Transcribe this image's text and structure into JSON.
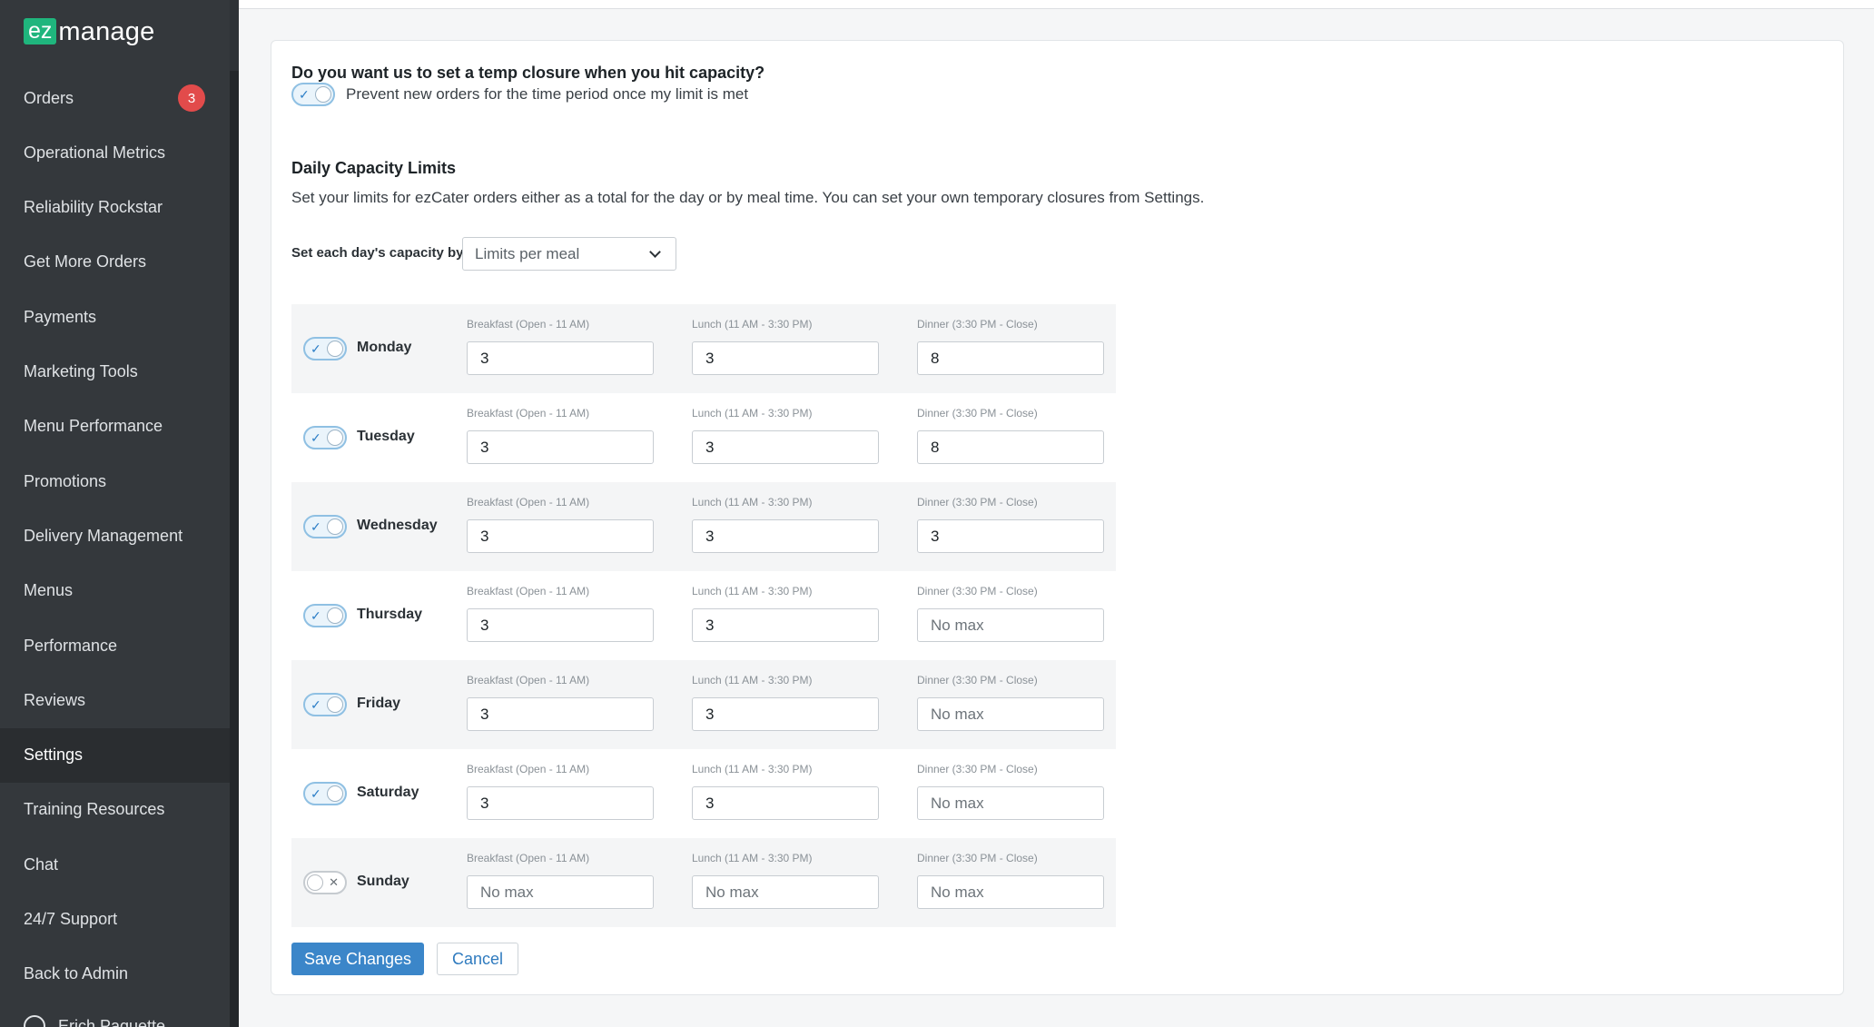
{
  "brand": {
    "logo_ez": "ez",
    "logo_manage": "manage"
  },
  "sidebar": {
    "items": [
      {
        "label": "Orders",
        "badge": "3"
      },
      {
        "label": "Operational Metrics"
      },
      {
        "label": "Reliability Rockstar"
      },
      {
        "label": "Get More Orders"
      },
      {
        "label": "Payments"
      },
      {
        "label": "Marketing Tools"
      },
      {
        "label": "Menu Performance"
      },
      {
        "label": "Promotions"
      },
      {
        "label": "Delivery Management"
      },
      {
        "label": "Menus"
      },
      {
        "label": "Performance"
      },
      {
        "label": "Reviews"
      },
      {
        "label": "Settings",
        "active": true
      },
      {
        "label": "Training Resources"
      },
      {
        "label": "Chat"
      },
      {
        "label": "24/7 Support"
      },
      {
        "label": "Back to Admin"
      }
    ],
    "user": "Erich Paquette"
  },
  "closure": {
    "question": "Do you want us to set a temp closure when you hit capacity?",
    "toggle_label": "Prevent new orders for the time period once my limit is met",
    "enabled": true
  },
  "capacity": {
    "title": "Daily Capacity Limits",
    "description": "Set your limits for ezCater orders either as a total for the day or by meal time. You can set your own temporary closures from Settings.",
    "set_by_label": "Set each day's capacity by",
    "set_by_value": "Limits per meal",
    "meal_labels": {
      "breakfast": "Breakfast (Open - 11 AM)",
      "lunch": "Lunch (11 AM - 3:30 PM)",
      "dinner": "Dinner (3:30 PM - Close)"
    },
    "placeholder": "No max",
    "days": [
      {
        "name": "Monday",
        "enabled": true,
        "breakfast": "3",
        "lunch": "3",
        "dinner": "8"
      },
      {
        "name": "Tuesday",
        "enabled": true,
        "breakfast": "3",
        "lunch": "3",
        "dinner": "8"
      },
      {
        "name": "Wednesday",
        "enabled": true,
        "breakfast": "3",
        "lunch": "3",
        "dinner": "3"
      },
      {
        "name": "Thursday",
        "enabled": true,
        "breakfast": "3",
        "lunch": "3",
        "dinner": ""
      },
      {
        "name": "Friday",
        "enabled": true,
        "breakfast": "3",
        "lunch": "3",
        "dinner": ""
      },
      {
        "name": "Saturday",
        "enabled": true,
        "breakfast": "3",
        "lunch": "3",
        "dinner": ""
      },
      {
        "name": "Sunday",
        "enabled": false,
        "breakfast": "",
        "lunch": "",
        "dinner": ""
      }
    ]
  },
  "actions": {
    "save_label": "Save Changes",
    "cancel_label": "Cancel"
  },
  "colors": {
    "sidebar_bg": "#34383c",
    "accent": "#3b86c9",
    "badge": "#e24b4b",
    "brand_green": "#1fb57d"
  },
  "icons": {
    "toggle_on": "check-icon",
    "toggle_off": "x-icon",
    "select": "chevron-down-icon",
    "user": "user-circle-icon"
  }
}
